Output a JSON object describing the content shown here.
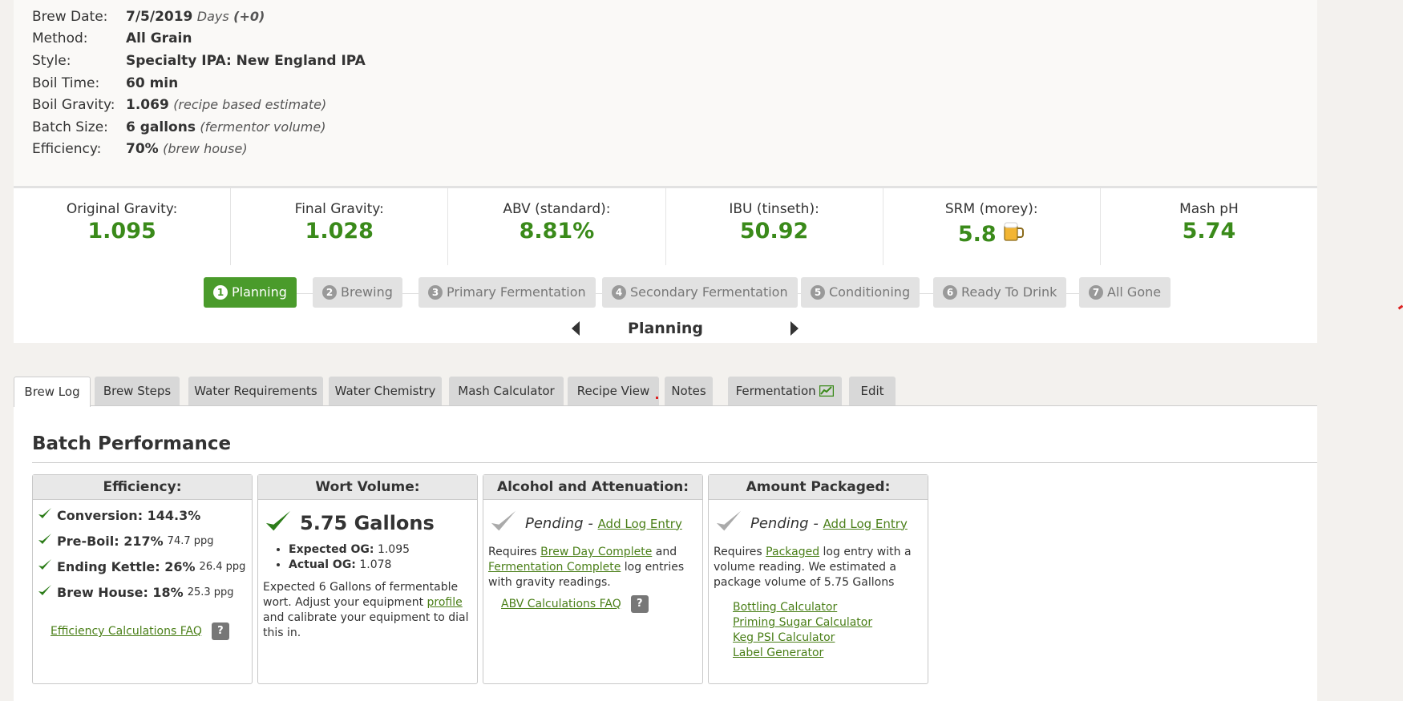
{
  "info": [
    {
      "label": "Brew Date:",
      "value": "7/5/2019",
      "note": "Days",
      "extra": "(+0)"
    },
    {
      "label": "Method:",
      "value": "All Grain",
      "note": "",
      "extra": ""
    },
    {
      "label": "Style:",
      "value": "Specialty IPA: New England IPA",
      "note": "",
      "extra": ""
    },
    {
      "label": "Boil Time:",
      "value": "60 min",
      "note": "",
      "extra": ""
    },
    {
      "label": "Boil Gravity:",
      "value": "1.069",
      "note": "(recipe based estimate)",
      "extra": ""
    },
    {
      "label": "Batch Size:",
      "value": "6 gallons",
      "note": "(fermentor volume)",
      "extra": ""
    },
    {
      "label": "Efficiency:",
      "value": "70%",
      "note": "(brew house)",
      "extra": ""
    }
  ],
  "stats": [
    {
      "label": "Original Gravity:",
      "value": "1.095"
    },
    {
      "label": "Final Gravity:",
      "value": "1.028"
    },
    {
      "label": "ABV (standard):",
      "value": "8.81%"
    },
    {
      "label": "IBU (tinseth):",
      "value": "50.92"
    },
    {
      "label": "SRM (morey):",
      "value": "5.8"
    },
    {
      "label": "Mash pH",
      "value": "5.74"
    }
  ],
  "steps": [
    {
      "num": "1",
      "label": "Planning"
    },
    {
      "num": "2",
      "label": "Brewing"
    },
    {
      "num": "3",
      "label": "Primary Fermentation"
    },
    {
      "num": "4",
      "label": "Secondary Fermentation"
    },
    {
      "num": "5",
      "label": "Conditioning"
    },
    {
      "num": "6",
      "label": "Ready To Drink"
    },
    {
      "num": "7",
      "label": "All Gone"
    }
  ],
  "current_stage": "Planning",
  "tabs": [
    "Brew Log",
    "Brew Steps",
    "Water Requirements",
    "Water Chemistry",
    "Mash Calculator",
    "Recipe View",
    "Notes",
    "Fermentation",
    "Edit"
  ],
  "section_title": "Batch Performance",
  "efficiency_card": {
    "title": "Efficiency:",
    "rows": [
      {
        "label": "Conversion: 144.3%",
        "small": ""
      },
      {
        "label": "Pre-Boil: 217%",
        "small": "74.7 ppg"
      },
      {
        "label": "Ending Kettle: 26%",
        "small": "26.4 ppg"
      },
      {
        "label": "Brew House: 18%",
        "small": "25.3 ppg"
      }
    ],
    "faq": "Efficiency Calculations FAQ",
    "help": "?"
  },
  "wort_card": {
    "title": "Wort Volume:",
    "volume": "5.75 Gallons",
    "expected_label": "Expected OG:",
    "expected_value": "1.095",
    "actual_label": "Actual OG:",
    "actual_value": "1.078",
    "note_1": "Expected 6 Gallons of fermentable wort. Adjust your equipment ",
    "note_link": "profile",
    "note_2": " and calibrate your equipment to dial this in."
  },
  "alcohol_card": {
    "title": "Alcohol and Attenuation:",
    "pending": "Pending -",
    "add_link": "Add Log Entry",
    "req_1": "Requires ",
    "req_link_1": "Brew Day Complete",
    "req_2": " and ",
    "req_link_2": "Fermentation Complete",
    "req_3": " log entries with gravity readings.",
    "faq": "ABV Calculations FAQ",
    "help": "?"
  },
  "packaged_card": {
    "title": "Amount Packaged:",
    "pending": "Pending -",
    "add_link": "Add Log Entry",
    "req_1": "Requires ",
    "req_link": "Packaged",
    "req_2": " log entry with a volume reading. We estimated a package volume of 5.75 Gallons",
    "links": [
      "Bottling Calculator",
      "Priming Sugar Calculator",
      "Keg PSI Calculator",
      "Label Generator"
    ]
  },
  "colors": {
    "accent": "#4a9b2b",
    "value_green": "#3a8a1a",
    "link_green": "#4a7f18",
    "tab_bg": "#d8d8d8"
  }
}
